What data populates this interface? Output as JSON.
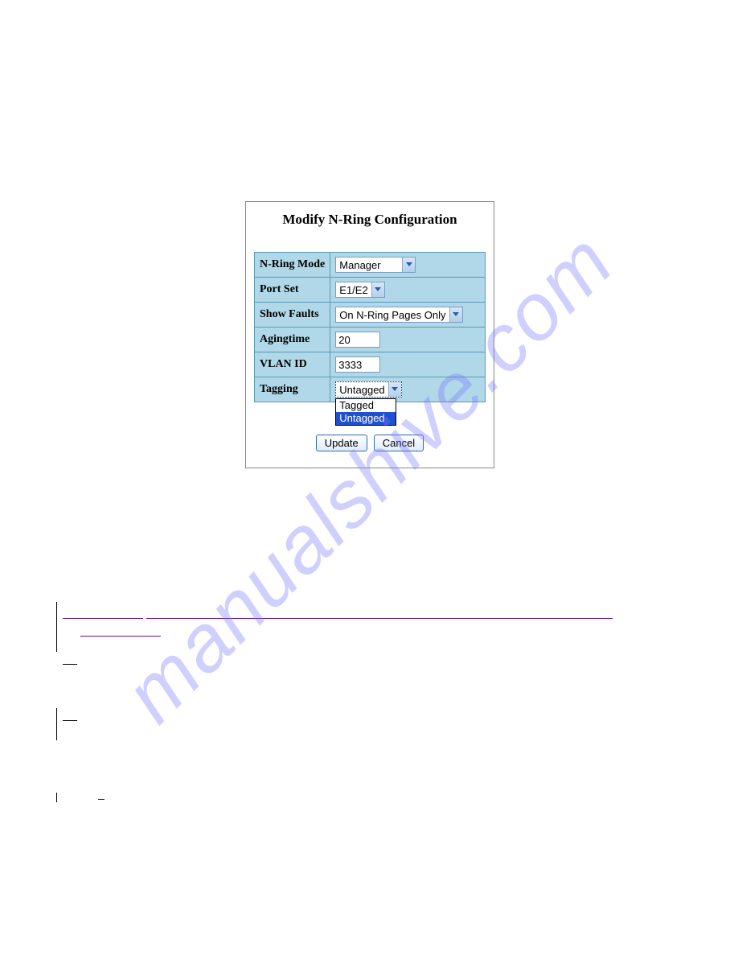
{
  "panel": {
    "title": "Modify N-Ring Configuration",
    "rows": {
      "nRingMode": {
        "label": "N-Ring Mode",
        "value": "Manager"
      },
      "portSet": {
        "label": "Port Set",
        "value": "E1/E2"
      },
      "showFaults": {
        "label": "Show Faults",
        "value": "On N-Ring Pages Only"
      },
      "agingTime": {
        "label": "Agingtime",
        "value": "20"
      },
      "vlanId": {
        "label": "VLAN ID",
        "value": "3333"
      },
      "tagging": {
        "label": "Tagging",
        "value": "Untagged"
      }
    },
    "taggingOptions": {
      "opt1": "Tagged",
      "opt2": "Untagged"
    },
    "buttons": {
      "update": "Update",
      "cancel": "Cancel"
    }
  }
}
